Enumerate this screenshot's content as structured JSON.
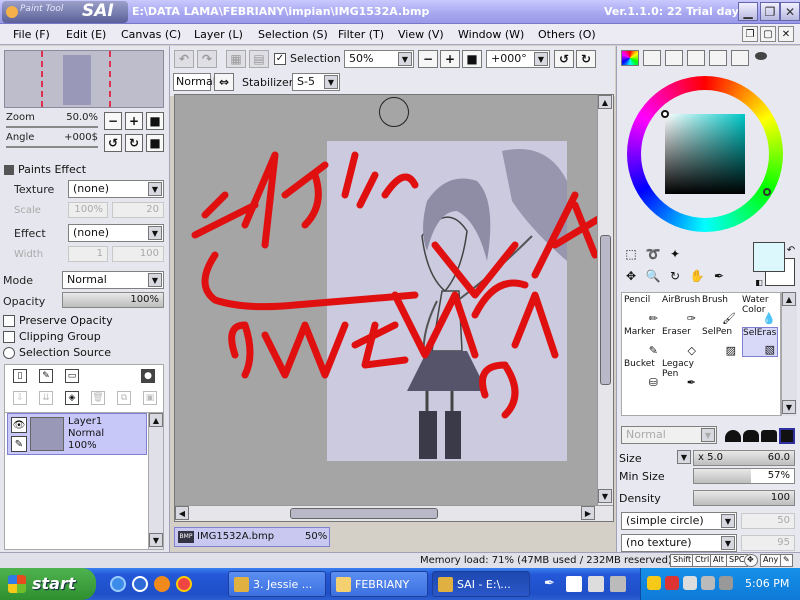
{
  "titlebar": {
    "app_name": "SAI",
    "app_prefix": "Paint Tool",
    "path": "E:\\DATA LAMA\\FEBRIANY\\impian\\IMG1532A.bmp",
    "version": "Ver.1.1.0: 22 Trial day"
  },
  "menu": {
    "items": [
      "File (F)",
      "Edit (E)",
      "Canvas (C)",
      "Layer (L)",
      "Selection (S)",
      "Filter (T)",
      "View (V)",
      "Window (W)",
      "Others (O)"
    ]
  },
  "navigator": {
    "zoom_label": "Zoom",
    "zoom_value": "50.0%",
    "angle_label": "Angle",
    "angle_value": "+000$"
  },
  "paints_effect": {
    "header": "Paints Effect",
    "texture_label": "Texture",
    "texture_value": "(none)",
    "scale_label": "Scale",
    "scale_value": "100%",
    "scale_num": "20",
    "effect_label": "Effect",
    "effect_value": "(none)",
    "width_label": "Width",
    "width_value": "1",
    "width_num": "100"
  },
  "layer_props": {
    "mode_label": "Mode",
    "mode_value": "Normal",
    "opacity_label": "Opacity",
    "opacity_value": "100%",
    "opacity_fraction": 1.0,
    "preserve_opacity": "Preserve Opacity",
    "clipping_group": "Clipping Group",
    "selection_source": "Selection Source"
  },
  "layers": [
    {
      "name": "Layer1",
      "mode": "Normal",
      "opacity": "100%"
    }
  ],
  "toolbar": {
    "selection_label": "Selection",
    "zoom_select": "50%",
    "rotation_select": "+000°",
    "blend_mode": "Normal",
    "stabilizer_label": "Stabilizer",
    "stabilizer_value": "S-5"
  },
  "canvas": {
    "file_tab_name": "IMG1532A.bmp",
    "file_tab_zoom": "50%"
  },
  "brush_tools": [
    {
      "label": "Pencil",
      "icon": "pencil-icon"
    },
    {
      "label": "AirBrush",
      "icon": "airbrush-icon"
    },
    {
      "label": "Brush",
      "icon": "brush-icon"
    },
    {
      "label": "Water Color",
      "icon": "watercolor-icon"
    },
    {
      "label": "Marker",
      "icon": "marker-icon"
    },
    {
      "label": "Eraser",
      "icon": "eraser-icon"
    },
    {
      "label": "SelPen",
      "icon": "selpen-icon"
    },
    {
      "label": "SelEras",
      "icon": "seleras-icon"
    },
    {
      "label": "Bucket",
      "icon": "bucket-icon"
    },
    {
      "label": "Legacy Pen",
      "icon": "legacypen-icon"
    }
  ],
  "brush_settings": {
    "blend_mode": "Normal",
    "size_label": "Size",
    "size_multiplier": "x 5.0",
    "size_value": "60.0",
    "min_size_label": "Min Size",
    "min_size_value": "57%",
    "min_size_fraction": 0.57,
    "density_label": "Density",
    "density_value": "100",
    "density_fraction": 1.0,
    "shape_value": "(simple circle)",
    "shape_num": "50",
    "texture_value": "(no texture)",
    "texture_num": "95"
  },
  "colors": {
    "primary": "#dcf8fc",
    "secondary": "#ffffff"
  },
  "statusbar": {
    "memory": "Memory load: 71% (47MB used / 232MB reserved)",
    "keys": [
      "Shift",
      "Ctrl",
      "Alt",
      "SPC",
      "Any"
    ]
  },
  "taskbar": {
    "start_label": "start",
    "tasks": [
      {
        "label": "3. Jessie ...",
        "active": false
      },
      {
        "label": "FEBRIANY",
        "active": false
      },
      {
        "label": "SAI - E:\\...",
        "active": true
      }
    ],
    "clock": "5:06 PM"
  }
}
